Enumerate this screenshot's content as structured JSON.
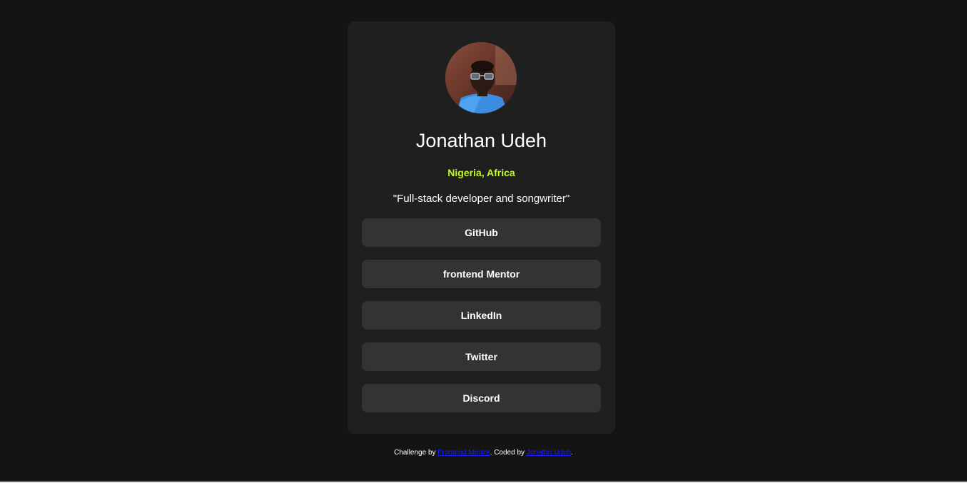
{
  "profile": {
    "name": "Jonathan Udeh",
    "location": "Nigeria, Africa",
    "bio": "\"Full-stack developer and songwriter\""
  },
  "links": [
    {
      "label": "GitHub"
    },
    {
      "label": "frontend Mentor"
    },
    {
      "label": "LinkedIn"
    },
    {
      "label": "Twitter"
    },
    {
      "label": "Discord"
    }
  ],
  "attribution": {
    "prefix": "Challenge by ",
    "challenge_link": "Frontend Mentor",
    "middle": ". Coded by ",
    "author_link": "Jonathn Udeh",
    "suffix": "."
  },
  "colors": {
    "background": "#141414",
    "card": "#1f1f1f",
    "button": "#333333",
    "accent": "#c4f82a",
    "link": "#1d1dff"
  }
}
